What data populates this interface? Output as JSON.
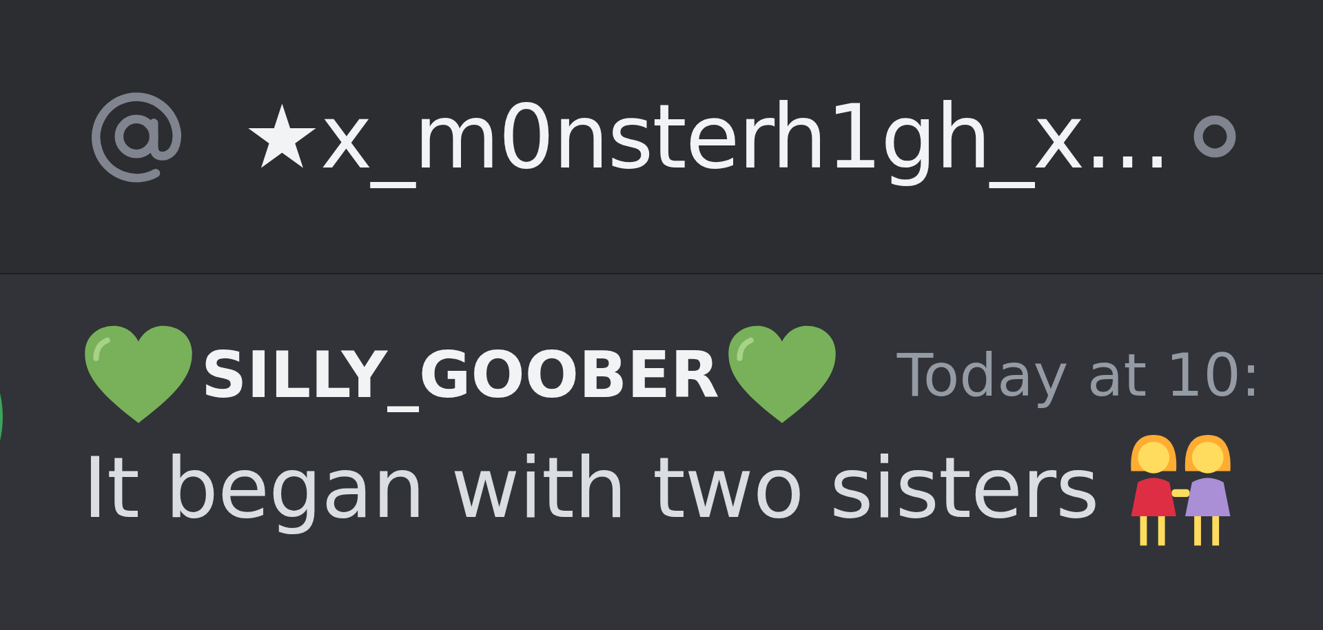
{
  "header": {
    "title": "★x_m0nsterh1gh_x…",
    "offline": true
  },
  "message": {
    "author": "SILLY_GOOBER",
    "timestamp": "Today at 10:",
    "text": "It began with two sisters"
  }
}
